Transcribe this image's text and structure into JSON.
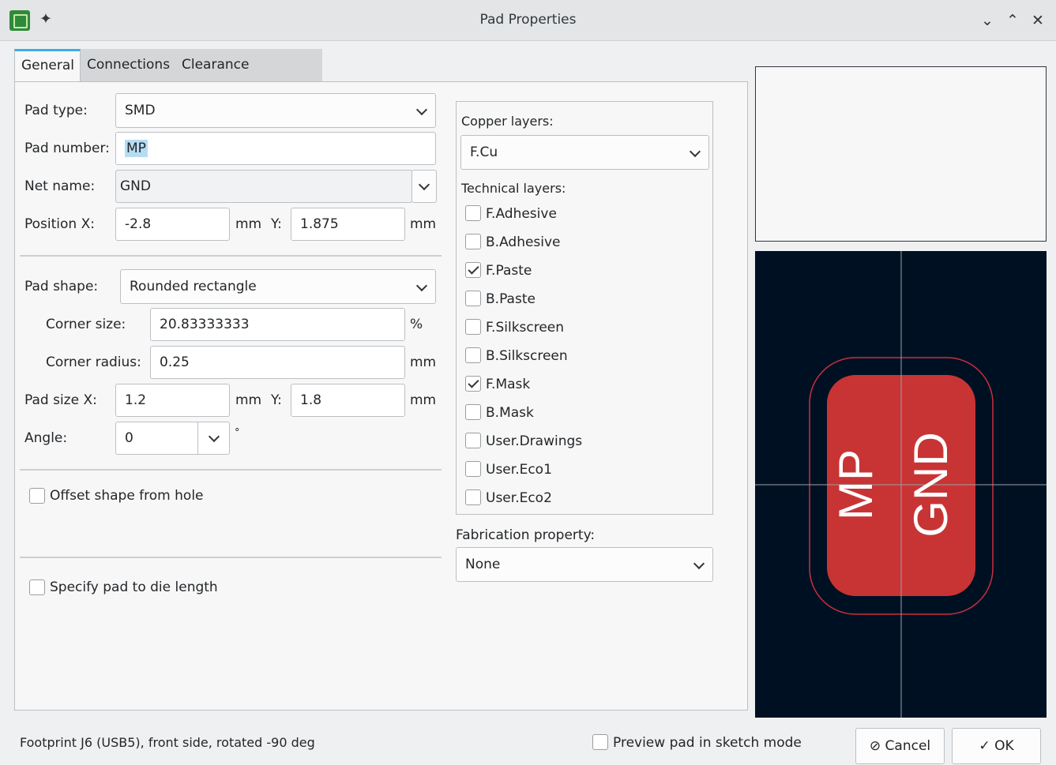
{
  "window": {
    "title": "Pad Properties"
  },
  "tabs": [
    {
      "label": "General"
    },
    {
      "label": "Connections"
    },
    {
      "label": "Clearance Overrides"
    }
  ],
  "general": {
    "pad_type": {
      "label": "Pad type:",
      "value": "SMD"
    },
    "pad_number": {
      "label": "Pad number:",
      "value": "MP"
    },
    "net_name": {
      "label": "Net name:",
      "value": "GND"
    },
    "position": {
      "label": "Position X:",
      "x": "-2.8",
      "x_unit": "mm",
      "y_label": "Y:",
      "y": "1.875",
      "y_unit": "mm"
    },
    "pad_shape": {
      "label": "Pad shape:",
      "value": "Rounded rectangle"
    },
    "corner_size": {
      "label": "Corner size:",
      "value": "20.83333333",
      "unit": "%"
    },
    "corner_radius": {
      "label": "Corner radius:",
      "value": "0.25",
      "unit": "mm"
    },
    "pad_size": {
      "label": "Pad size X:",
      "x": "1.2",
      "x_unit": "mm",
      "y_label": "Y:",
      "y": "1.8",
      "y_unit": "mm"
    },
    "angle": {
      "label": "Angle:",
      "value": "0",
      "unit": "°"
    },
    "offset_shape": {
      "label": "Offset shape from hole",
      "checked": false
    },
    "die_length": {
      "label": "Specify pad to die length",
      "checked": false
    }
  },
  "layers": {
    "copper_label": "Copper layers:",
    "copper_value": "F.Cu",
    "technical_label": "Technical layers:",
    "technical": [
      {
        "name": "F.Adhesive",
        "checked": false
      },
      {
        "name": "B.Adhesive",
        "checked": false
      },
      {
        "name": "F.Paste",
        "checked": true
      },
      {
        "name": "B.Paste",
        "checked": false
      },
      {
        "name": "F.Silkscreen",
        "checked": false
      },
      {
        "name": "B.Silkscreen",
        "checked": false
      },
      {
        "name": "F.Mask",
        "checked": true
      },
      {
        "name": "B.Mask",
        "checked": false
      },
      {
        "name": "User.Drawings",
        "checked": false
      },
      {
        "name": "User.Eco1",
        "checked": false
      },
      {
        "name": "User.Eco2",
        "checked": false
      }
    ],
    "fabrication_label": "Fabrication property:",
    "fabrication_value": "None"
  },
  "preview": {
    "pad_number_text": "MP",
    "net_text": "GND",
    "pad_color": "#c83434",
    "clearance_color": "#c8303c",
    "bg_color": "#001023"
  },
  "footer": {
    "status": "Footprint J6 (USB5), front side, rotated -90 deg",
    "sketch_mode_label": "Preview pad in sketch mode",
    "cancel_label": "Cancel",
    "ok_label": "OK"
  }
}
